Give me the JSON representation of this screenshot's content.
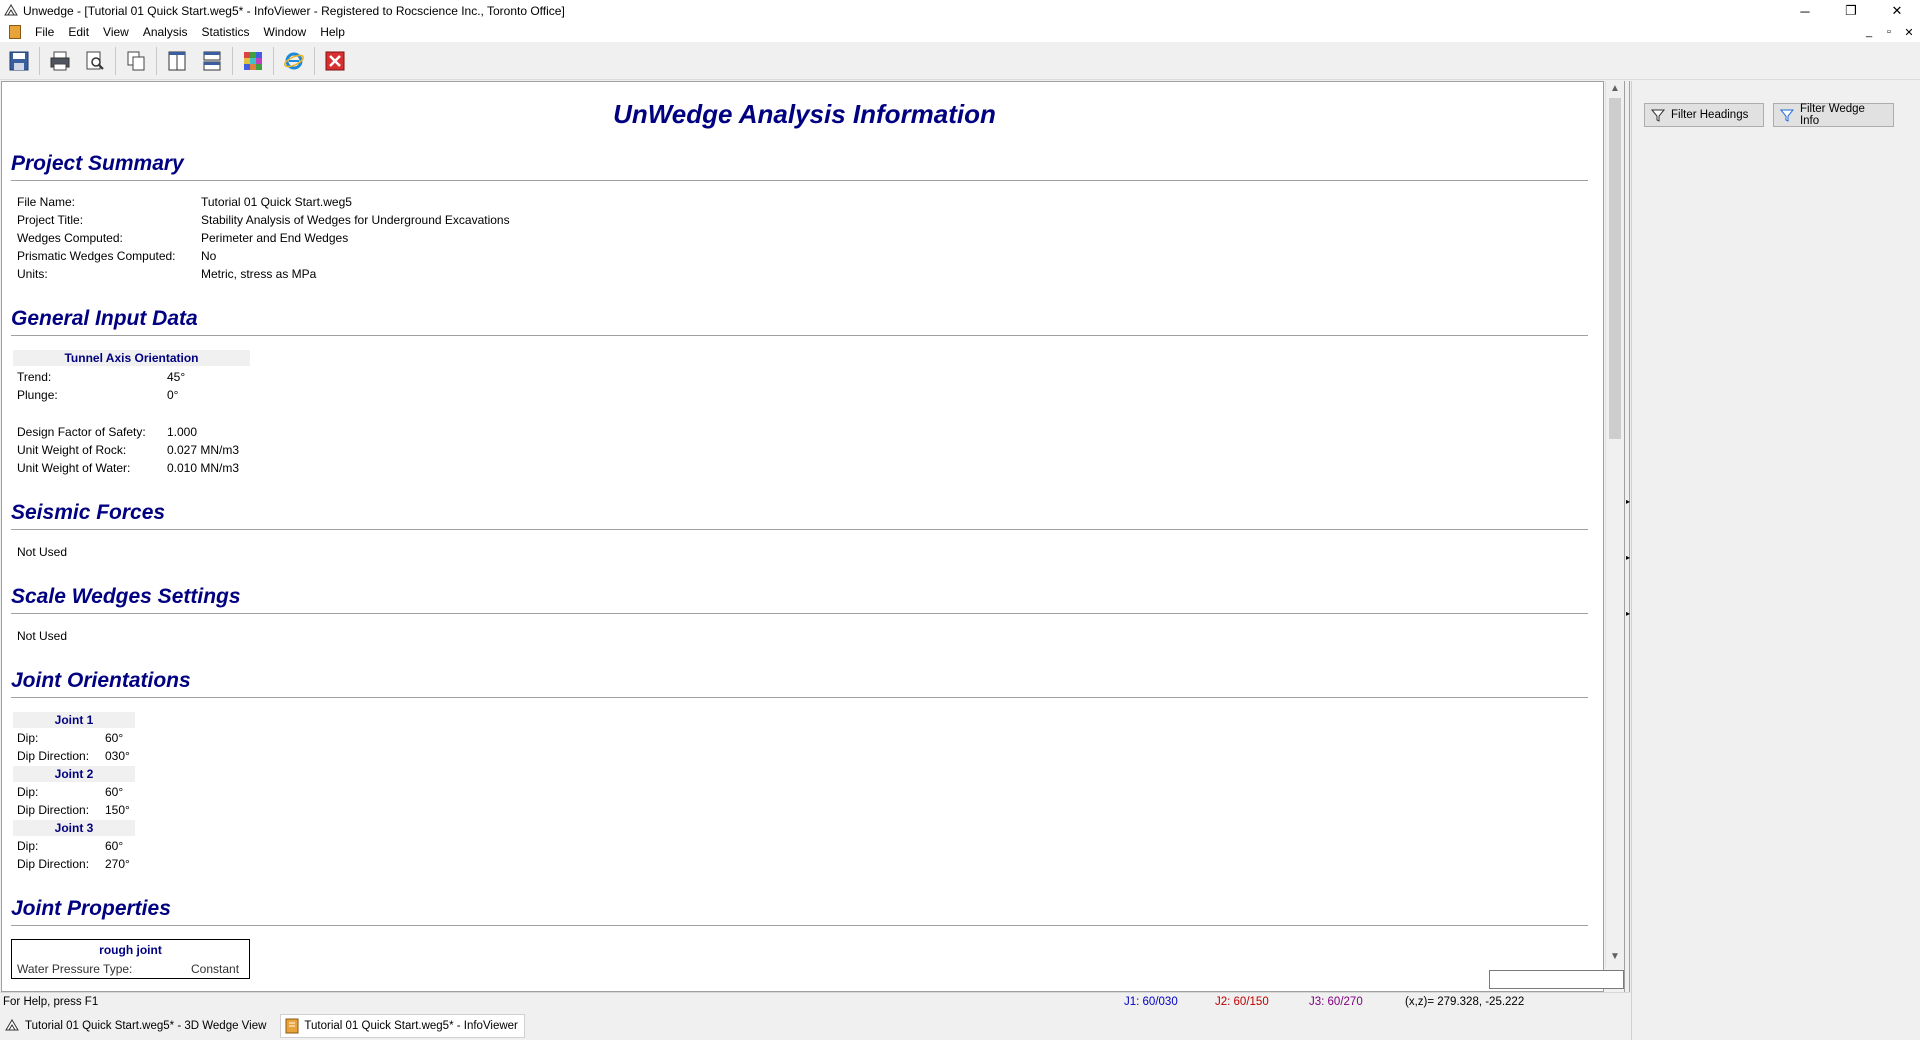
{
  "window": {
    "title": "Unwedge - [Tutorial 01 Quick Start.weg5* - InfoViewer - Registered to Rocscience Inc., Toronto Office]",
    "minimize": "─",
    "restore": "❐",
    "close": "✕"
  },
  "menu": {
    "items": [
      "File",
      "Edit",
      "View",
      "Analysis",
      "Statistics",
      "Window",
      "Help"
    ]
  },
  "toolbar": {
    "icons": [
      "save-icon",
      "print-icon",
      "print-preview-icon",
      "copy-icon",
      "tile-vertical-icon",
      "tile-horizontal-icon",
      "grid-icon",
      "internet-explorer-icon",
      "close-view-icon"
    ]
  },
  "report": {
    "title": "UnWedge Analysis Information",
    "project_summary": {
      "heading": "Project Summary",
      "rows": [
        {
          "label": "File Name:",
          "value": "Tutorial 01 Quick Start.weg5"
        },
        {
          "label": "Project Title:",
          "value": "Stability Analysis of Wedges for Underground Excavations"
        },
        {
          "label": "Wedges Computed:",
          "value": "Perimeter and End Wedges"
        },
        {
          "label": "Prismatic Wedges Computed:",
          "value": "No"
        },
        {
          "label": "Units:",
          "value": "Metric, stress as MPa"
        }
      ]
    },
    "general_input": {
      "heading": "General Input Data",
      "table_header": "Tunnel Axis Orientation",
      "orientation": [
        {
          "label": "Trend:",
          "value": "45°"
        },
        {
          "label": "Plunge:",
          "value": "0°"
        }
      ],
      "params": [
        {
          "label": "Design Factor of Safety:",
          "value": "1.000"
        },
        {
          "label": "Unit Weight of Rock:",
          "value": "0.027 MN/m3"
        },
        {
          "label": "Unit Weight of Water:",
          "value": "0.010 MN/m3"
        }
      ]
    },
    "seismic": {
      "heading": "Seismic Forces",
      "text": "Not Used"
    },
    "scale": {
      "heading": "Scale Wedges Settings",
      "text": "Not Used"
    },
    "joint_orientations": {
      "heading": "Joint Orientations",
      "joints": [
        {
          "name": "Joint 1",
          "dip_label": "Dip:",
          "dip": "60°",
          "dd_label": "Dip Direction:",
          "dd": "030°"
        },
        {
          "name": "Joint 2",
          "dip_label": "Dip:",
          "dip": "60°",
          "dd_label": "Dip Direction:",
          "dd": "150°"
        },
        {
          "name": "Joint 3",
          "dip_label": "Dip:",
          "dip": "60°",
          "dd_label": "Dip Direction:",
          "dd": "270°"
        }
      ]
    },
    "joint_properties": {
      "heading": "Joint Properties",
      "box_title": "rough joint",
      "partial_label": "Water Pressure Type:",
      "partial_value": "Constant"
    }
  },
  "right_pane": {
    "filter_headings": "Filter Headings",
    "filter_wedge_info": "Filter Wedge Info"
  },
  "status": {
    "help": "For Help, press F1",
    "j1": "J1: 60/030",
    "j2": "J2: 60/150",
    "j3": "J3: 60/270",
    "coords": "(x,z)= 279.328, -25.222",
    "j1_color": "#0000c0",
    "j2_color": "#c00000",
    "j3_color": "#800080"
  },
  "tabs": [
    {
      "label": "Tutorial 01 Quick Start.weg5* - 3D Wedge View",
      "active": false
    },
    {
      "label": "Tutorial 01 Quick Start.weg5* - InfoViewer",
      "active": true
    }
  ]
}
